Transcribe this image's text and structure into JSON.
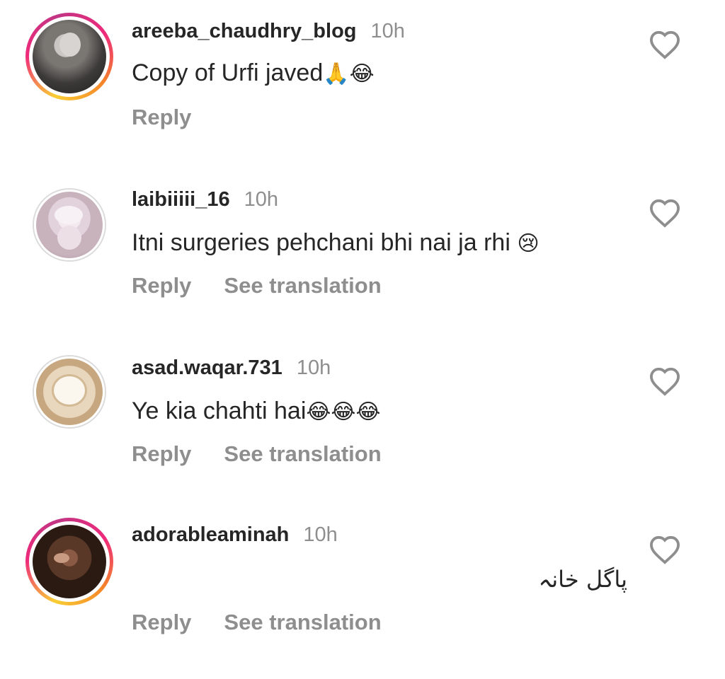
{
  "comments": [
    {
      "username": "areeba_chaudhry_blog",
      "time": "10h",
      "text": "Copy of Urfi javed",
      "emojis": "🙏😂",
      "reply_label": "Reply",
      "translation_label": ""
    },
    {
      "username": "laibiiiii_16",
      "time": "10h",
      "text": "Itni surgeries pehchani bhi nai ja rhi ",
      "emojis": "😢",
      "reply_label": "Reply",
      "translation_label": "See translation"
    },
    {
      "username": "asad.waqar.731",
      "time": "10h",
      "text": "Ye kia chahti hai",
      "emojis": "😂😂😂",
      "reply_label": "Reply",
      "translation_label": "See translation"
    },
    {
      "username": "adorableaminah",
      "time": "10h",
      "text": "پاگل خانہ",
      "emojis": "",
      "reply_label": "Reply",
      "translation_label": "See translation"
    }
  ],
  "icons": {
    "like": "heart-outline-icon"
  },
  "colors": {
    "text": "#262626",
    "muted": "#8e8e8e",
    "story_ring_start": "#f9ce34",
    "story_ring_mid": "#ee2a7b",
    "story_ring_end": "#c13584"
  }
}
